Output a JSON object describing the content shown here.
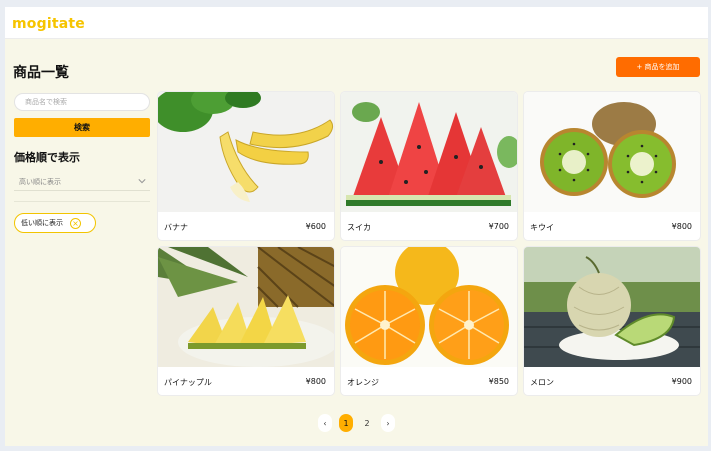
{
  "header": {
    "logo": "mogitate"
  },
  "main": {
    "title": "商品一覧",
    "add_button": "+ 商品を追加"
  },
  "sidebar": {
    "search_placeholder": "商品名で検索",
    "search_button": "検索",
    "sort_title": "価格順で表示",
    "sort_select_value": "高い順に表示",
    "active_filter": "低い順に表示",
    "filter_clear": "×"
  },
  "products": [
    {
      "name": "バナナ",
      "price": "¥600",
      "image": "banana"
    },
    {
      "name": "スイカ",
      "price": "¥700",
      "image": "watermelon"
    },
    {
      "name": "キウイ",
      "price": "¥800",
      "image": "kiwi"
    },
    {
      "name": "パイナップル",
      "price": "¥800",
      "image": "pineapple"
    },
    {
      "name": "オレンジ",
      "price": "¥850",
      "image": "orange"
    },
    {
      "name": "メロン",
      "price": "¥900",
      "image": "melon"
    }
  ],
  "pagination": {
    "prev": "‹",
    "pages": [
      "1",
      "2"
    ],
    "current": "1",
    "next": "›"
  },
  "colors": {
    "accent": "#ffae00",
    "add_button": "#ff6c00",
    "logo": "#f6c400"
  }
}
